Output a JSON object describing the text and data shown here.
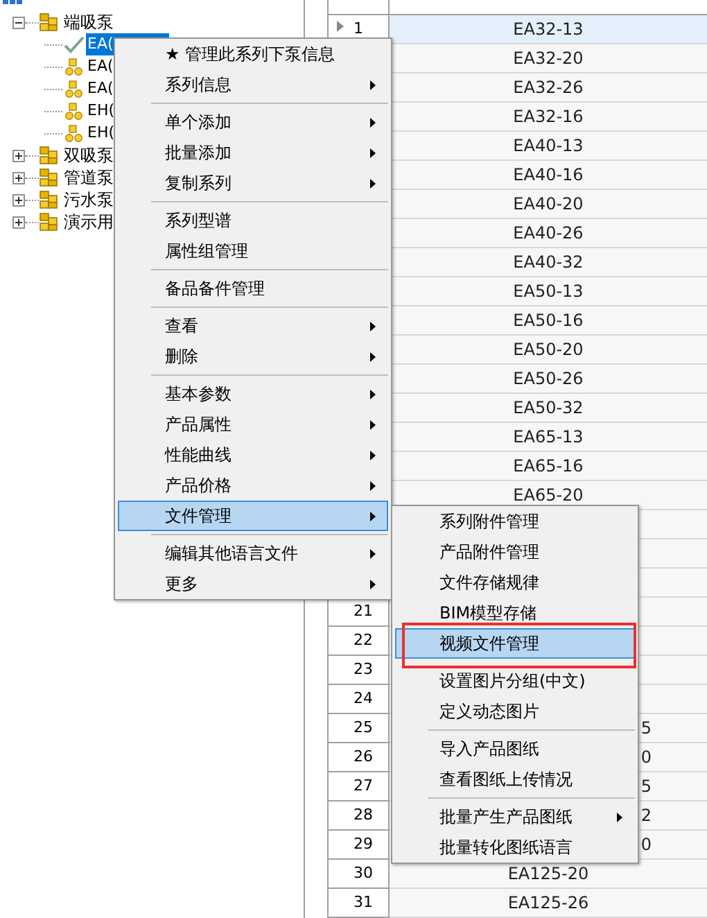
{
  "tree": {
    "children": [
      {
        "label": "端吸泵",
        "expanded": true,
        "children": [
          {
            "label": "EA(",
            "selected": true
          },
          {
            "label": "EA(",
            "selected": false
          },
          {
            "label": "EA(",
            "selected": false
          },
          {
            "label": "EH(",
            "selected": false
          },
          {
            "label": "EH(",
            "selected": false
          }
        ]
      },
      {
        "label": "双吸泵",
        "expanded": false
      },
      {
        "label": "管道泵",
        "expanded": false
      },
      {
        "label": "污水泵",
        "expanded": false
      },
      {
        "label": "演示用",
        "expanded": false
      }
    ]
  },
  "grid": {
    "rows": [
      {
        "number": "1",
        "model": "EA32-13",
        "selected": true
      },
      {
        "model": "EA32-20",
        "selected": false
      },
      {
        "model": "EA32-26",
        "selected": false
      },
      {
        "model": "EA32-16",
        "selected": false
      },
      {
        "model": "EA40-13",
        "selected": false
      },
      {
        "model": "EA40-16",
        "selected": false
      },
      {
        "model": "EA40-20",
        "selected": false
      },
      {
        "model": "EA40-26",
        "selected": false
      },
      {
        "model": "EA40-32",
        "selected": false
      },
      {
        "model": "EA50-13",
        "selected": false
      },
      {
        "model": "EA50-16",
        "selected": false
      },
      {
        "model": "EA50-20",
        "selected": false
      },
      {
        "model": "EA50-26",
        "selected": false
      },
      {
        "model": "EA50-32",
        "selected": false
      },
      {
        "model": "EA65-13",
        "selected": false
      },
      {
        "model": "EA65-16",
        "selected": false
      },
      {
        "model": "EA65-20",
        "selected": false
      },
      {
        "selected": false
      },
      {
        "selected": false
      },
      {
        "selected": false
      },
      {
        "number": "21",
        "selected": false
      },
      {
        "number": "22",
        "selected": false
      },
      {
        "number": "23",
        "selected": false
      },
      {
        "number": "24",
        "selected": false
      },
      {
        "number": "25",
        "model_tail": "5",
        "selected": false
      },
      {
        "number": "26",
        "model_tail": "0",
        "selected": false
      },
      {
        "number": "27",
        "model_tail": "5",
        "selected": false
      },
      {
        "number": "28",
        "model_tail": "2",
        "selected": false
      },
      {
        "number": "29",
        "model_tail": "0",
        "selected": false
      },
      {
        "number": "30",
        "model": "EA125-20",
        "selected": false
      },
      {
        "number": "31",
        "model": "EA125-26",
        "selected": false
      }
    ]
  },
  "context_menu": {
    "items": [
      {
        "kind": "item",
        "label": "★ 管理此系列下泵信息",
        "submenu": false,
        "selected": false
      },
      {
        "kind": "item",
        "label": "系列信息",
        "submenu": true,
        "selected": false
      },
      {
        "kind": "separator"
      },
      {
        "kind": "item",
        "label": "单个添加",
        "submenu": true,
        "selected": false
      },
      {
        "kind": "item",
        "label": "批量添加",
        "submenu": true,
        "selected": false
      },
      {
        "kind": "item",
        "label": "复制系列",
        "submenu": true,
        "selected": false
      },
      {
        "kind": "separator"
      },
      {
        "kind": "item",
        "label": "系列型谱",
        "submenu": false,
        "selected": false
      },
      {
        "kind": "item",
        "label": "属性组管理",
        "submenu": false,
        "selected": false
      },
      {
        "kind": "separator"
      },
      {
        "kind": "item",
        "label": "备品备件管理",
        "submenu": false,
        "selected": false
      },
      {
        "kind": "separator"
      },
      {
        "kind": "item",
        "label": "查看",
        "submenu": true,
        "selected": false
      },
      {
        "kind": "item",
        "label": "删除",
        "submenu": true,
        "selected": false
      },
      {
        "kind": "separator"
      },
      {
        "kind": "item",
        "label": "基本参数",
        "submenu": true,
        "selected": false
      },
      {
        "kind": "item",
        "label": "产品属性",
        "submenu": true,
        "selected": false
      },
      {
        "kind": "item",
        "label": "性能曲线",
        "submenu": true,
        "selected": false
      },
      {
        "kind": "item",
        "label": "产品价格",
        "submenu": true,
        "selected": false
      },
      {
        "kind": "item",
        "label": "文件管理",
        "submenu": true,
        "selected": true
      },
      {
        "kind": "separator"
      },
      {
        "kind": "item",
        "label": "编辑其他语言文件",
        "submenu": true,
        "selected": false
      },
      {
        "kind": "item",
        "label": "更多",
        "submenu": true,
        "selected": false
      }
    ]
  },
  "submenu": {
    "items": [
      {
        "kind": "item",
        "label": "系列附件管理",
        "submenu": false,
        "selected": false,
        "annotated": false
      },
      {
        "kind": "item",
        "label": "产品附件管理",
        "submenu": false,
        "selected": false,
        "annotated": false
      },
      {
        "kind": "item",
        "label": "文件存储规律",
        "submenu": false,
        "selected": false,
        "annotated": false
      },
      {
        "kind": "item",
        "label": "BIM模型存储",
        "submenu": false,
        "selected": false,
        "annotated": false
      },
      {
        "kind": "item",
        "label": "视频文件管理",
        "submenu": false,
        "selected": true,
        "annotated": true
      },
      {
        "kind": "gap"
      },
      {
        "kind": "item",
        "label": "设置图片分组(中文)",
        "submenu": false,
        "selected": false,
        "annotated": false
      },
      {
        "kind": "item",
        "label": "定义动态图片",
        "submenu": false,
        "selected": false,
        "annotated": false
      },
      {
        "kind": "separator"
      },
      {
        "kind": "item",
        "label": "导入产品图纸",
        "submenu": false,
        "selected": false,
        "annotated": false
      },
      {
        "kind": "item",
        "label": "查看图纸上传情况",
        "submenu": false,
        "selected": false,
        "annotated": false
      },
      {
        "kind": "separator"
      },
      {
        "kind": "item",
        "label": "批量产生产品图纸",
        "submenu": true,
        "selected": false,
        "annotated": false
      },
      {
        "kind": "item",
        "label": "批量转化图纸语言",
        "submenu": false,
        "selected": false,
        "annotated": false
      }
    ]
  }
}
